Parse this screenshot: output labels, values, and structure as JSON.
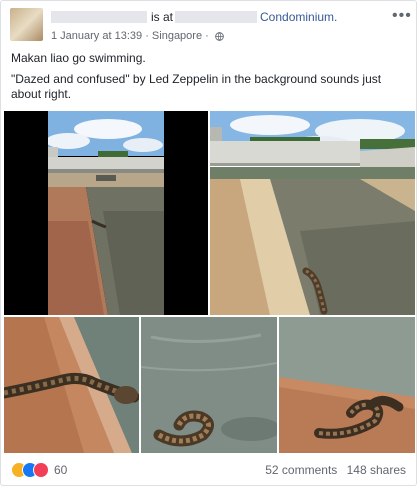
{
  "post": {
    "at_text": "is at",
    "location": "Condominium.",
    "date": "1 January at 13:39",
    "place": "Singapore",
    "separator": "·",
    "more_label": "•••",
    "text_line1": "Makan liao go swimming.",
    "text_line2": "\"Dazed and confused\" by Led Zeppelin in the background sounds just about right."
  },
  "footer": {
    "reaction_count": "60",
    "comments": "52 comments",
    "shares": "148 shares"
  },
  "icons": {
    "audience": "globe-icon",
    "reactions": [
      "wow-reaction-icon",
      "like-reaction-icon",
      "love-reaction-icon"
    ],
    "menu": "more-options-icon"
  },
  "colors": {
    "link": "#385898",
    "meta": "#616770",
    "like": "#1877f2",
    "love": "#f33e58",
    "wow": "#f7b125"
  }
}
